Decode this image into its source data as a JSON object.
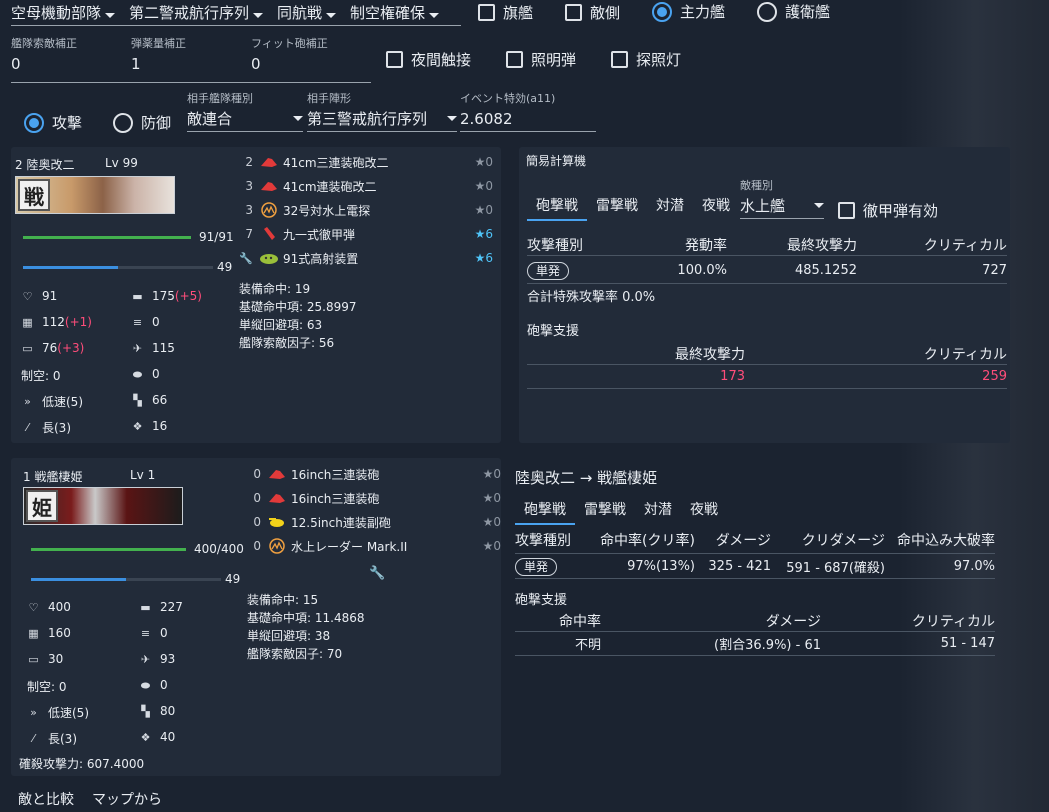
{
  "top": {
    "selects": [
      "空母機動部隊",
      "第二警戒航行序列",
      "同航戦",
      "制空権確保"
    ],
    "checks": [
      {
        "label": "旗艦",
        "checked": false
      },
      {
        "label": "敵側",
        "checked": false
      }
    ],
    "radios": [
      {
        "label": "主力艦",
        "checked": true
      },
      {
        "label": "護衛艦",
        "checked": false
      }
    ],
    "fields": [
      {
        "label": "艦隊索敵補正",
        "value": "0"
      },
      {
        "label": "弾薬量補正",
        "value": "1"
      },
      {
        "label": "フィット砲補正",
        "value": "0"
      }
    ],
    "checks2": [
      {
        "label": "夜間触接"
      },
      {
        "label": "照明弾"
      },
      {
        "label": "探照灯"
      }
    ],
    "attack_label": "攻撃",
    "defense_label": "防御",
    "enemy_fleet_type": {
      "label": "相手艦隊種別",
      "value": "敵連合"
    },
    "enemy_formation": {
      "label": "相手陣形",
      "value": "第三警戒航行序列"
    },
    "event": {
      "label": "イベント特効(a11)",
      "value": "2.6082"
    }
  },
  "ship1": {
    "index": "2",
    "name": "陸奥改二",
    "lv": "Lv 99",
    "kanji": "戦",
    "hp": "91/91",
    "hp_frac": 1.0,
    "ammo": "49",
    "ammo_frac": 0.5,
    "equip": [
      {
        "num": "2",
        "icon": "main-gun-icon",
        "color": "#e23a3a",
        "name": "41cm三連装砲改二",
        "star": "★0",
        "blue": false
      },
      {
        "num": "3",
        "icon": "main-gun-icon",
        "color": "#e23a3a",
        "name": "41cm連装砲改二",
        "star": "★0",
        "blue": false
      },
      {
        "num": "3",
        "icon": "radar-icon",
        "color": "#f0a040",
        "name": "32号対水上電探",
        "star": "★0",
        "blue": false
      },
      {
        "num": "7",
        "icon": "ap-shell-icon",
        "color": "#e23a3a",
        "name": "九一式徹甲弾",
        "star": "★6",
        "blue": true
      },
      {
        "num": "",
        "icon": "aa-director-icon",
        "color": "#9abf3a",
        "name": "91式高射装置",
        "star": "★6",
        "blue": true
      }
    ],
    "info": [
      "装備命中: 19",
      "基礎命中項: 25.8997",
      "単縦回避項: 63",
      "艦隊索敵因子: 56"
    ],
    "stats": {
      "hp": "91",
      "fire": "175",
      "fire_bonus": "(+5)",
      "armor": "112",
      "armor_bonus": "(+1)",
      "torp": "0",
      "evasion": "76",
      "evasion_bonus": "(+3)",
      "aa": "115",
      "air": "制空: 0",
      "asw": "0",
      "speed": "低速(5)",
      "los": "66",
      "range": "長(3)",
      "luck": "16"
    }
  },
  "calc": {
    "title": "簡易計算機",
    "tabs": [
      "砲撃戦",
      "雷撃戦",
      "対潜",
      "夜戦"
    ],
    "enemy_type": {
      "label": "敵種別",
      "value": "水上艦"
    },
    "ap_label": "徹甲弾有効",
    "headers": [
      "攻撃種別",
      "発動率",
      "最終攻撃力",
      "クリティカル"
    ],
    "row": {
      "type": "単発",
      "rate": "100.0%",
      "power": "485.1252",
      "crit": "727"
    },
    "special": "合計特殊攻撃率 0.0%",
    "support_title": "砲撃支援",
    "support_headers": [
      "最終攻撃力",
      "クリティカル"
    ],
    "support_row": {
      "power": "173",
      "crit": "259"
    }
  },
  "ship2": {
    "index": "1",
    "name": "戦艦棲姫",
    "lv": "Lv 1",
    "kanji": "姫",
    "hp": "400/400",
    "hp_frac": 1.0,
    "ammo": "49",
    "ammo_frac": 0.5,
    "equip": [
      {
        "num": "0",
        "icon": "main-gun-icon",
        "color": "#e23a3a",
        "name": "16inch三連装砲",
        "star": "★0"
      },
      {
        "num": "0",
        "icon": "main-gun-icon",
        "color": "#e23a3a",
        "name": "16inch三連装砲",
        "star": "★0"
      },
      {
        "num": "0",
        "icon": "secondary-gun-icon",
        "color": "#f2d21a",
        "name": "12.5inch連装副砲",
        "star": "★0"
      },
      {
        "num": "0",
        "icon": "radar-icon",
        "color": "#f0a040",
        "name": "水上レーダー Mark.II",
        "star": "★0"
      }
    ],
    "info": [
      "装備命中: 15",
      "基礎命中項: 11.4868",
      "単縦回避項: 38",
      "艦隊索敵因子: 70"
    ],
    "stats": {
      "hp": "400",
      "fire": "227",
      "armor": "160",
      "torp": "0",
      "evasion": "30",
      "aa": "93",
      "air": "制空: 0",
      "asw": "0",
      "speed": "低速(5)",
      "los": "80",
      "range": "長(3)",
      "luck": "40"
    },
    "kill": "確殺攻撃力: 607.4000"
  },
  "battle": {
    "title": "陸奥改二 → 戦艦棲姫",
    "tabs": [
      "砲撃戦",
      "雷撃戦",
      "対潜",
      "夜戦"
    ],
    "headers": [
      "攻撃種別",
      "命中率(クリ率)",
      "ダメージ",
      "クリダメージ",
      "命中込み大破率"
    ],
    "row": {
      "type": "単発",
      "hit": "97%(13%)",
      "dmg": "325 - 421",
      "crit": "591 - 687(確殺)",
      "break": "97.0%"
    },
    "support_title": "砲撃支援",
    "support_headers": [
      "命中率",
      "ダメージ",
      "クリティカル"
    ],
    "support_row": {
      "hit": "不明",
      "dmg": "(割合36.9%) - 61",
      "crit": "51 - 147"
    }
  },
  "footer": {
    "compare": "敵と比較",
    "from_map": "マップから"
  }
}
